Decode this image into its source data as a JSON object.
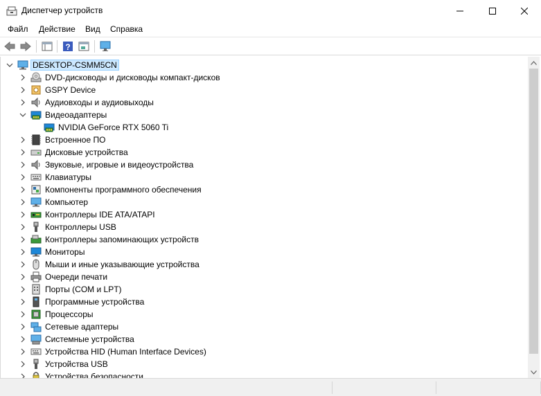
{
  "window": {
    "title": "Диспетчер устройств"
  },
  "menu": {
    "items": [
      "Файл",
      "Действие",
      "Вид",
      "Справка"
    ]
  },
  "tree": {
    "root": "DESKTOP-CSMM5CN",
    "items": [
      {
        "label": "DVD-дисководы и дисководы компакт-дисков",
        "icon": "dvd-drive-icon",
        "expanded": false
      },
      {
        "label": "GSPY Device",
        "icon": "gspy-device-icon",
        "expanded": false
      },
      {
        "label": "Аудиовходы и аудиовыходы",
        "icon": "speaker-icon",
        "expanded": false
      },
      {
        "label": "Видеоадаптеры",
        "icon": "display-adapter-icon",
        "expanded": true
      },
      {
        "label": "NVIDIA GeForce RTX 5060 Ti",
        "icon": "display-adapter-icon",
        "child": true
      },
      {
        "label": "Встроенное ПО",
        "icon": "firmware-icon",
        "expanded": false
      },
      {
        "label": "Дисковые устройства",
        "icon": "disk-drive-icon",
        "expanded": false
      },
      {
        "label": "Звуковые, игровые и видеоустройства",
        "icon": "speaker-icon",
        "expanded": false
      },
      {
        "label": "Клавиатуры",
        "icon": "keyboard-icon",
        "expanded": false
      },
      {
        "label": "Компоненты программного обеспечения",
        "icon": "software-component-icon",
        "expanded": false
      },
      {
        "label": "Компьютер",
        "icon": "computer-icon",
        "expanded": false
      },
      {
        "label": "Контроллеры IDE ATA/ATAPI",
        "icon": "ide-controller-icon",
        "expanded": false
      },
      {
        "label": "Контроллеры USB",
        "icon": "usb-icon",
        "expanded": false
      },
      {
        "label": "Контроллеры запоминающих устройств",
        "icon": "storage-controller-icon",
        "expanded": false
      },
      {
        "label": "Мониторы",
        "icon": "monitor-icon",
        "expanded": false
      },
      {
        "label": "Мыши и иные указывающие устройства",
        "icon": "mouse-icon",
        "expanded": false
      },
      {
        "label": "Очереди печати",
        "icon": "printer-icon",
        "expanded": false
      },
      {
        "label": "Порты (COM и LPT)",
        "icon": "port-icon",
        "expanded": false
      },
      {
        "label": "Программные устройства",
        "icon": "software-device-icon",
        "expanded": false
      },
      {
        "label": "Процессоры",
        "icon": "processor-icon",
        "expanded": false
      },
      {
        "label": "Сетевые адаптеры",
        "icon": "network-adapter-icon",
        "expanded": false
      },
      {
        "label": "Системные устройства",
        "icon": "system-device-icon",
        "expanded": false
      },
      {
        "label": "Устройства HID (Human Interface Devices)",
        "icon": "hid-icon",
        "expanded": false
      },
      {
        "label": "Устройства USB",
        "icon": "usb-icon",
        "expanded": false
      },
      {
        "label": "Устройства безопасности",
        "icon": "security-device-icon",
        "expanded": false
      }
    ]
  },
  "colors": {
    "selection_bg": "#cce8ff",
    "selection_border": "#99d1ff",
    "monitor_blue": "#1e88d8",
    "chevron": "#444444"
  }
}
